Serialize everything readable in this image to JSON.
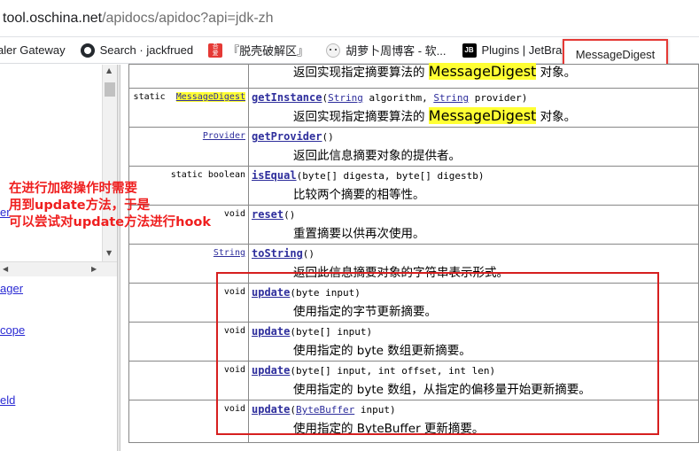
{
  "browser": {
    "url_host": "tool.oschina.net",
    "url_path": "/apidocs/apidoc?api=jdk-zh",
    "bookmarks": [
      {
        "label": "aler Gateway",
        "icon": "none"
      },
      {
        "label": "Search · jackfrued",
        "icon": "github-icon"
      },
      {
        "label": "『脱壳破解区』",
        "icon": "seal-icon"
      },
      {
        "label": "胡萝卜周博客 - 软...",
        "icon": "avatar-icon"
      },
      {
        "label": "Plugins | JetBrains",
        "icon": "jetbrains-icon"
      }
    ],
    "tooltip": "MessageDigest"
  },
  "left_frame": {
    "links": [
      "er",
      "ager",
      "cope",
      "eld"
    ]
  },
  "methods": [
    {
      "modifier": [],
      "name": "",
      "params": [],
      "desc_before": "返回实现指定摘要算法的",
      "desc_highlight": "MessageDigest",
      "desc_after": "对象。"
    },
    {
      "modifier": [
        {
          "text": "static",
          "link": false
        },
        {
          "text": "MessageDigest",
          "link": true,
          "highlight": true
        }
      ],
      "name": "getInstance",
      "params": [
        {
          "text": "(",
          "link": false
        },
        {
          "text": "String",
          "link": true
        },
        {
          "text": " algorithm, ",
          "link": false
        },
        {
          "text": "String",
          "link": true
        },
        {
          "text": " provider)",
          "link": false
        }
      ],
      "desc_before": "返回实现指定摘要算法的",
      "desc_highlight": "MessageDigest",
      "desc_after": "对象。"
    },
    {
      "modifier": [
        {
          "text": "Provider",
          "link": true
        }
      ],
      "name": "getProvider",
      "params": [
        {
          "text": "()",
          "link": false
        }
      ],
      "desc_before": "返回此信息摘要对象的提供者。",
      "desc_highlight": "",
      "desc_after": ""
    },
    {
      "modifier": [
        {
          "text": "static boolean",
          "link": false
        }
      ],
      "name": "isEqual",
      "params": [
        {
          "text": "(byte[] digesta, byte[] digestb)",
          "link": false
        }
      ],
      "desc_before": "比较两个摘要的相等性。",
      "desc_highlight": "",
      "desc_after": ""
    },
    {
      "modifier": [
        {
          "text": "void",
          "link": false
        }
      ],
      "name": "reset",
      "params": [
        {
          "text": "()",
          "link": false
        }
      ],
      "desc_before": "重置摘要以供再次使用。",
      "desc_highlight": "",
      "desc_after": ""
    },
    {
      "modifier": [
        {
          "text": "String",
          "link": true
        }
      ],
      "name": "toString",
      "params": [
        {
          "text": "()",
          "link": false
        }
      ],
      "desc_before": "返回此信息摘要对象的字符串表示形式。",
      "desc_highlight": "",
      "desc_after": ""
    },
    {
      "modifier": [
        {
          "text": "void",
          "link": false
        }
      ],
      "name": "update",
      "params": [
        {
          "text": "(byte input)",
          "link": false
        }
      ],
      "desc_before": "使用指定的字节更新摘要。",
      "desc_highlight": "",
      "desc_after": ""
    },
    {
      "modifier": [
        {
          "text": "void",
          "link": false
        }
      ],
      "name": "update",
      "params": [
        {
          "text": "(byte[] input)",
          "link": false
        }
      ],
      "desc_before": "使用指定的 byte 数组更新摘要。",
      "desc_highlight": "",
      "desc_after": ""
    },
    {
      "modifier": [
        {
          "text": "void",
          "link": false
        }
      ],
      "name": "update",
      "params": [
        {
          "text": "(byte[] input, int offset, int len)",
          "link": false
        }
      ],
      "desc_before": "使用指定的 byte 数组，从指定的偏移量开始更新摘要。",
      "desc_highlight": "",
      "desc_after": ""
    },
    {
      "modifier": [
        {
          "text": "void",
          "link": false
        }
      ],
      "name": "update",
      "params": [
        {
          "text": "(",
          "link": false
        },
        {
          "text": "ByteBuffer",
          "link": true
        },
        {
          "text": " input)",
          "link": false
        }
      ],
      "desc_before": "使用指定的 ByteBuffer 更新摘要。",
      "desc_highlight": "",
      "desc_after": ""
    }
  ],
  "annotation": {
    "lines": [
      "在进行加密操作时需要",
      "用到update方法，于是",
      "可以尝试对update方法进行hook"
    ],
    "color": "#ef1f1f"
  }
}
